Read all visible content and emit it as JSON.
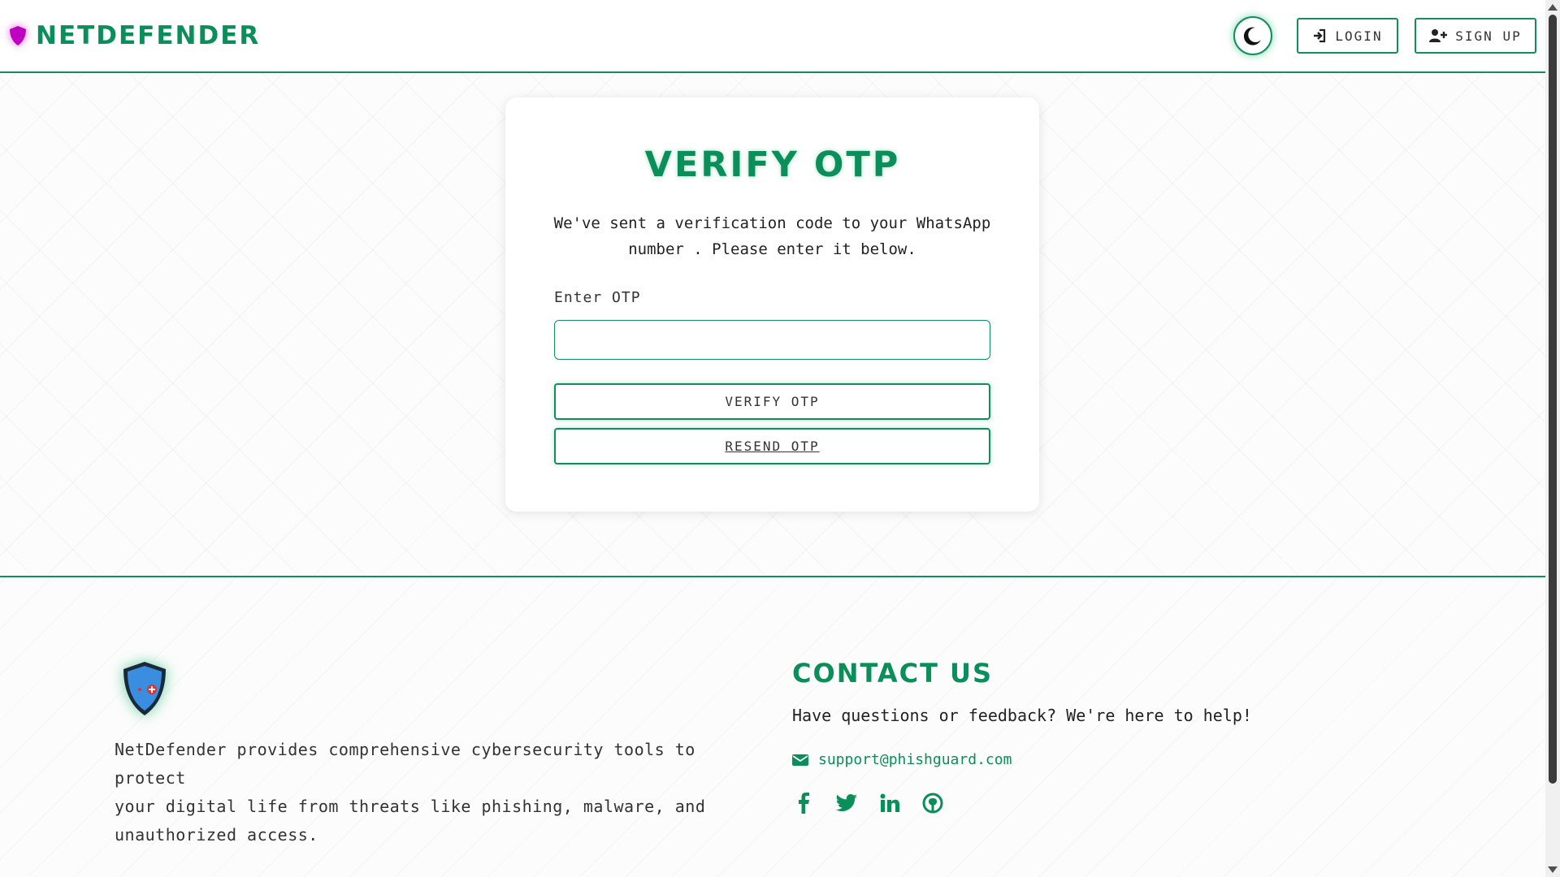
{
  "header": {
    "brand_name": "NETDEFENDER",
    "login_label": "LOGIN",
    "signup_label": "SIGN UP"
  },
  "card": {
    "title": "VERIFY OTP",
    "message_line1": "We've sent a verification code to your WhatsApp",
    "message_line2": "number . Please enter it below.",
    "otp_label": "Enter OTP",
    "otp_value": "",
    "verify_button": "VERIFY OTP",
    "resend_button": "RESEND OTP"
  },
  "footer": {
    "about_line1": "NetDefender provides comprehensive cybersecurity tools to protect",
    "about_line2": "your digital life from threats like phishing, malware, and",
    "about_line3": "unauthorized access.",
    "contact_title": "CONTACT US",
    "contact_text": "Have questions or feedback? We're here to help!",
    "email": "support@phishguard.com",
    "socials": [
      "facebook-icon",
      "twitter-icon",
      "linkedin-icon",
      "github-icon"
    ]
  },
  "colors": {
    "accent": "#0a8f5a",
    "brand_shield": "#c000c0",
    "footer_shield": "#3a8ee0"
  }
}
